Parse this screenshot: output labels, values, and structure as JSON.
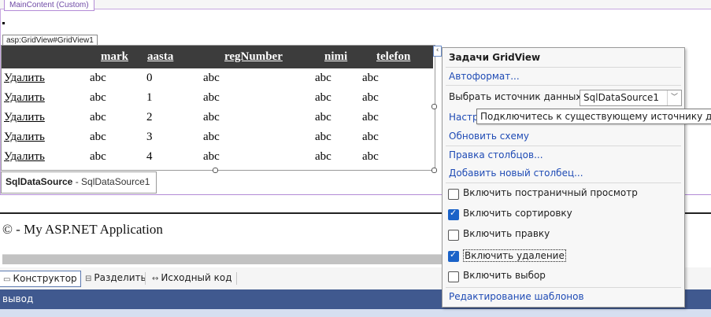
{
  "designer": {
    "main_content_tag": "MainContent (Custom)",
    "gridview_tag": "asp:GridView#GridView1",
    "columns": [
      "mark",
      "aasta",
      "regNumber",
      "nimi",
      "telefon"
    ],
    "delete_label": "Удалить",
    "rows": [
      [
        "abc",
        "0",
        "abc",
        "abc",
        "abc"
      ],
      [
        "abc",
        "1",
        "abc",
        "abc",
        "abc"
      ],
      [
        "abc",
        "2",
        "abc",
        "abc",
        "abc"
      ],
      [
        "abc",
        "3",
        "abc",
        "abc",
        "abc"
      ],
      [
        "abc",
        "4",
        "abc",
        "abc",
        "abc"
      ]
    ],
    "datasource_type": "SqlDataSource",
    "datasource_rest": " - SqlDataSource1",
    "copyright": "© - My ASP.NET Application"
  },
  "view_tabs": {
    "designer": "Конструктор",
    "split": "Разделить",
    "source": "Исходный код"
  },
  "output": {
    "title": "вывод"
  },
  "task_panel": {
    "title": "Задачи GridView",
    "autoformat": "Автоформат...",
    "choose_ds_label": "Выбрать источник данных",
    "choose_ds_value": "SqlDataSource1",
    "configure_ds": "Настр",
    "refresh_schema": "Обновить схему",
    "edit_columns": "Правка столбцов...",
    "add_column": "Добавить новый столбец...",
    "options": [
      {
        "label": "Включить постраничный просмотр",
        "checked": false
      },
      {
        "label": "Включить сортировку",
        "checked": true
      },
      {
        "label": "Включить правку",
        "checked": false
      },
      {
        "label": "Включить удаление",
        "checked": true
      },
      {
        "label": "Включить выбор",
        "checked": false
      }
    ],
    "edit_templates": "Редактирование шаблонов"
  },
  "tooltip": "Подключитесь к существующему источнику данных"
}
